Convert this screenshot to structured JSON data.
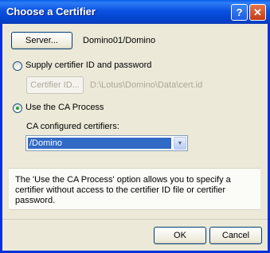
{
  "window": {
    "title": "Choose a Certifier",
    "help_glyph": "?",
    "close_glyph": "✕"
  },
  "server": {
    "button_label": "Server...",
    "value": "Domino01/Domino"
  },
  "option_supply": {
    "label": "Supply certifier ID and password",
    "selected": false
  },
  "certifier_id": {
    "button_label": "Certifier ID...",
    "path": "D:\\Lotus\\Domino\\Data\\cert.id"
  },
  "option_ca": {
    "label": "Use the CA Process",
    "selected": true
  },
  "ca_certifiers": {
    "label": "CA configured certifiers:",
    "selected_value": "/Domino"
  },
  "info_text": "The 'Use the CA Process' option allows you to specify a certifier without access to the certifier ID file or certifier password.",
  "footer": {
    "ok_label": "OK",
    "cancel_label": "Cancel"
  },
  "colors": {
    "titlebar": "#0a52e0",
    "dialog_bg": "#ece9d8",
    "selection": "#316ac5",
    "close_button": "#c23a12"
  }
}
